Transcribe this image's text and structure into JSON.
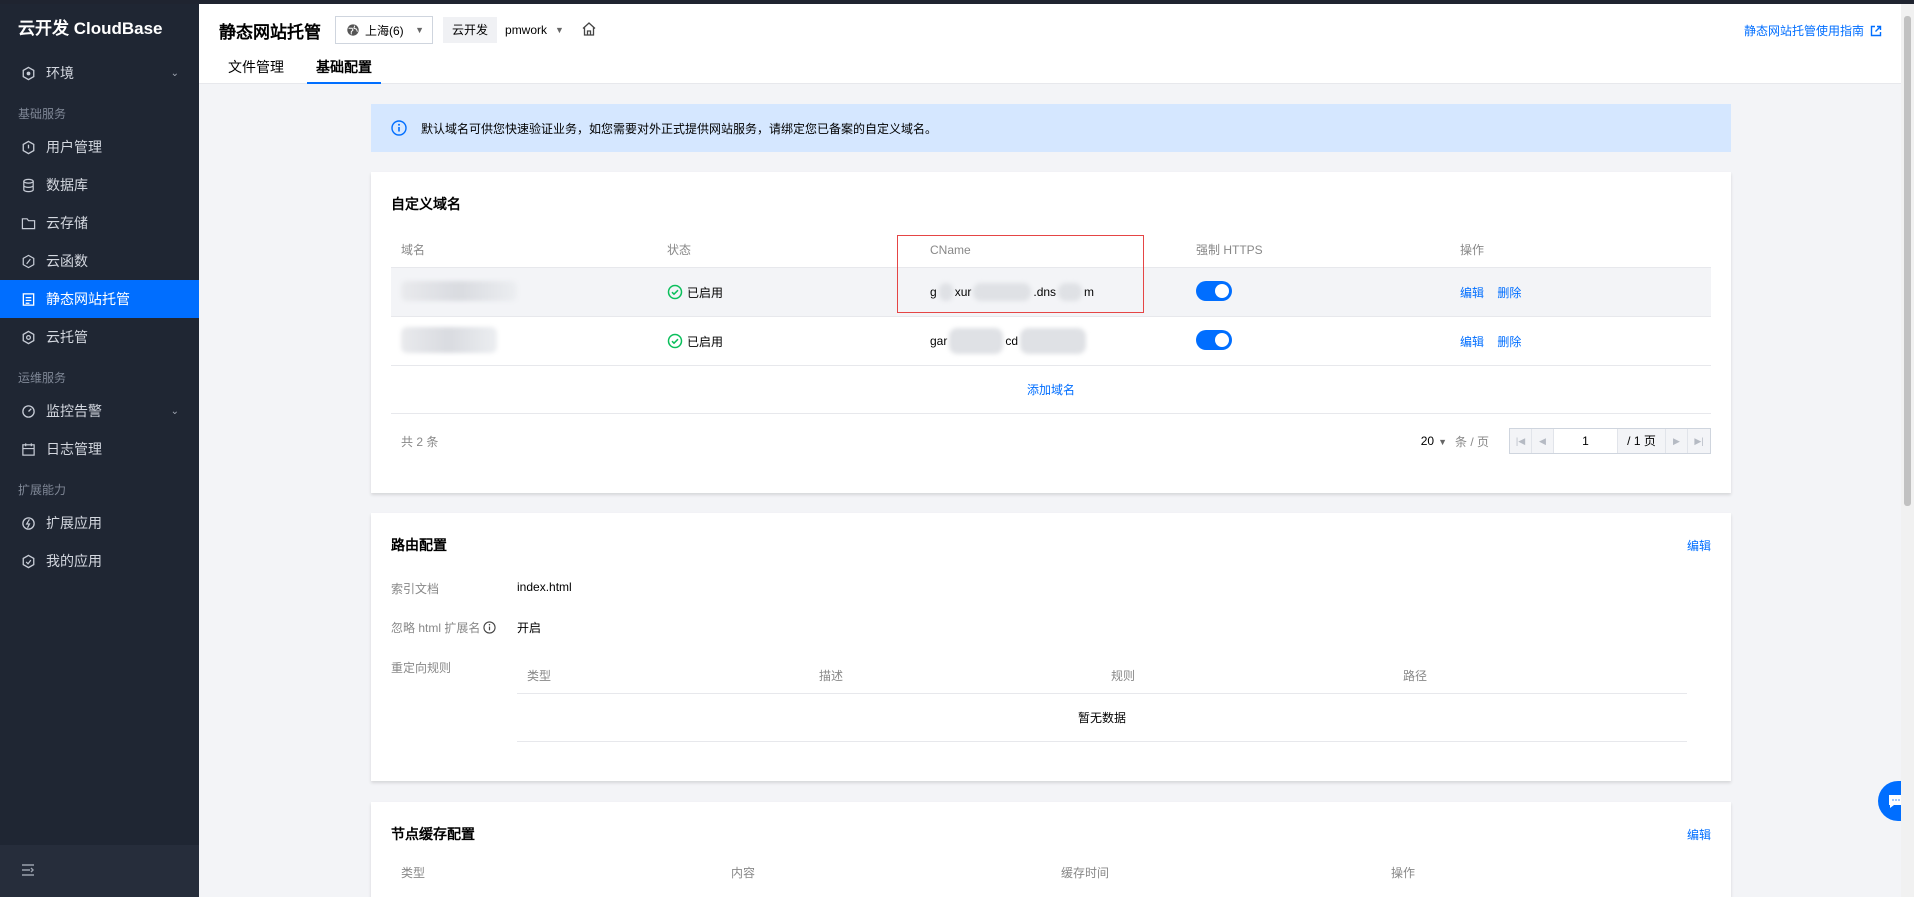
{
  "app": {
    "brand": "云开发 CloudBase"
  },
  "sidebar": {
    "env_item": "环境",
    "groups": [
      "基础服务",
      "运维服务",
      "扩展能力"
    ],
    "items": {
      "user_mgmt": "用户管理",
      "database": "数据库",
      "storage": "云存储",
      "functions": "云函数",
      "static_hosting": "静态网站托管",
      "cloud_hosting": "云托管",
      "monitoring": "监控告警",
      "logs": "日志管理",
      "ext_apps": "扩展应用",
      "my_apps": "我的应用"
    }
  },
  "header": {
    "title": "静态网站托管",
    "region": "上海(6)",
    "env_label": "云开发",
    "env_name": "pmwork",
    "guide_link": "静态网站托管使用指南",
    "tabs": [
      "文件管理",
      "基础配置"
    ],
    "active_tab": "基础配置"
  },
  "notice": "默认域名可供您快速验证业务，如您需要对外正式提供网站服务，请绑定您已备案的自定义域名。",
  "domains": {
    "title": "自定义域名",
    "columns": [
      "域名",
      "状态",
      "CName",
      "强制 HTTPS",
      "操作"
    ],
    "rows": [
      {
        "status": "已启用",
        "cname_start": "g",
        "cname_mid1": "xur",
        "cname_mid2": ".dns",
        "cname_end": "m",
        "https": true,
        "edit": "编辑",
        "delete": "删除"
      },
      {
        "status": "已启用",
        "cname_start": "gar",
        "cname_mid1": "cd",
        "cname_mid2": "",
        "cname_end": "",
        "https": true,
        "edit": "编辑",
        "delete": "删除"
      }
    ],
    "add_label": "添加域名",
    "total": "共 2 条",
    "page_size": "20",
    "per_page_label": "条 / 页",
    "page_value": "1",
    "page_total": "/ 1 页"
  },
  "route": {
    "title": "路由配置",
    "edit": "编辑",
    "index_label": "索引文档",
    "index_value": "index.html",
    "ignore_label": "忽略 html 扩展名",
    "ignore_value": "开启",
    "redirect_label": "重定向规则",
    "redirect_columns": [
      "类型",
      "描述",
      "规则",
      "路径"
    ],
    "empty": "暂无数据"
  },
  "cache": {
    "title": "节点缓存配置",
    "edit": "编辑",
    "columns": [
      "类型",
      "内容",
      "缓存时间",
      "操作"
    ]
  },
  "colors": {
    "accent": "#006eff",
    "sidebar_bg": "#1f2633",
    "success": "#0abf5b",
    "highlight_box": "#e54545"
  }
}
